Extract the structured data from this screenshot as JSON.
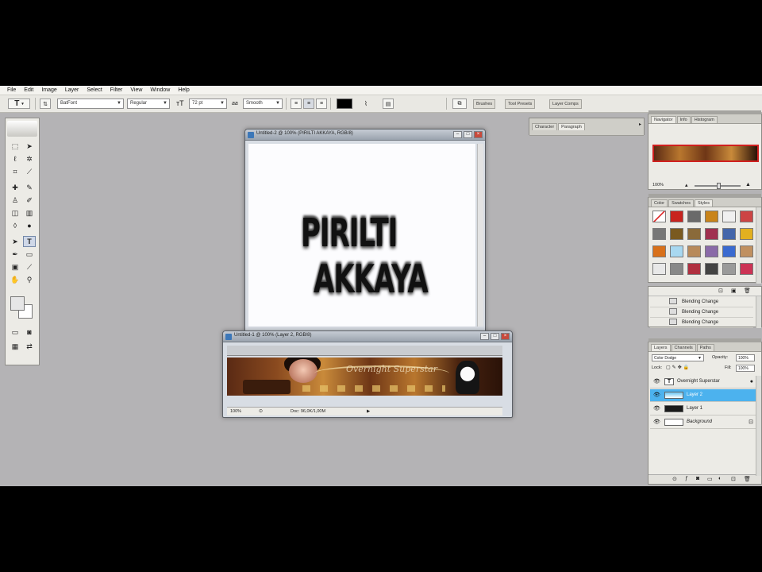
{
  "menu": [
    "File",
    "Edit",
    "Image",
    "Layer",
    "Select",
    "Filter",
    "View",
    "Window",
    "Help"
  ],
  "options_bar": {
    "tool_glyph": "T",
    "font_family": "BatFont",
    "font_style": "Regular",
    "font_size": "72 pt",
    "antialias": "Smooth",
    "aa_glyph": "aa",
    "wells": [
      "Brushes",
      "Tool Presets",
      "Layer Comps"
    ]
  },
  "doc1": {
    "title": "Untitled-2 @ 100% (PIRILTI   AKKAYA, RGB/8)",
    "text_line1": "PIRILTI",
    "text_line2": "AKKAYA"
  },
  "doc2": {
    "title": "Untitled-1 @ 100% (Layer 2, RGB/8)",
    "banner_text": "Overnight Superstar",
    "zoom": "100%",
    "doc_info": "Doc: 96,0K/1,00M"
  },
  "char_panel": {
    "tabs": [
      "Character",
      "Paragraph"
    ]
  },
  "navigator": {
    "tabs": [
      "Navigator",
      "Info",
      "Histogram"
    ],
    "zoom": "100%"
  },
  "styles_panel": {
    "tabs": [
      "Color",
      "Swatches",
      "Styles"
    ]
  },
  "history": {
    "rows": [
      "Blending Change",
      "Blending Change",
      "Blending Change"
    ]
  },
  "layers": {
    "tabs": [
      "Layers",
      "Channels",
      "Paths"
    ],
    "blend_mode": "Color Dodge",
    "opacity_label": "Opacity:",
    "opacity": "100%",
    "lock_label": "Lock:",
    "fill_label": "Fill:",
    "fill": "100%",
    "rows": [
      {
        "name": "Overnight Superstar",
        "selected": false
      },
      {
        "name": "Layer 2",
        "selected": true
      },
      {
        "name": "Layer 1",
        "selected": false
      },
      {
        "name": "Background",
        "selected": false
      }
    ]
  },
  "colors": {
    "workspace": "#b4b3b5",
    "selected_layer": "#4cb2ee",
    "panel_bg": "#ecebe6"
  },
  "icons": [
    "move-icon",
    "marquee-icon",
    "lasso-icon",
    "crop-icon",
    "brush-icon",
    "eraser-icon",
    "text-icon",
    "pen-icon",
    "hand-icon",
    "zoom-icon",
    "eye-icon",
    "lock-icon",
    "fx-icon"
  ]
}
